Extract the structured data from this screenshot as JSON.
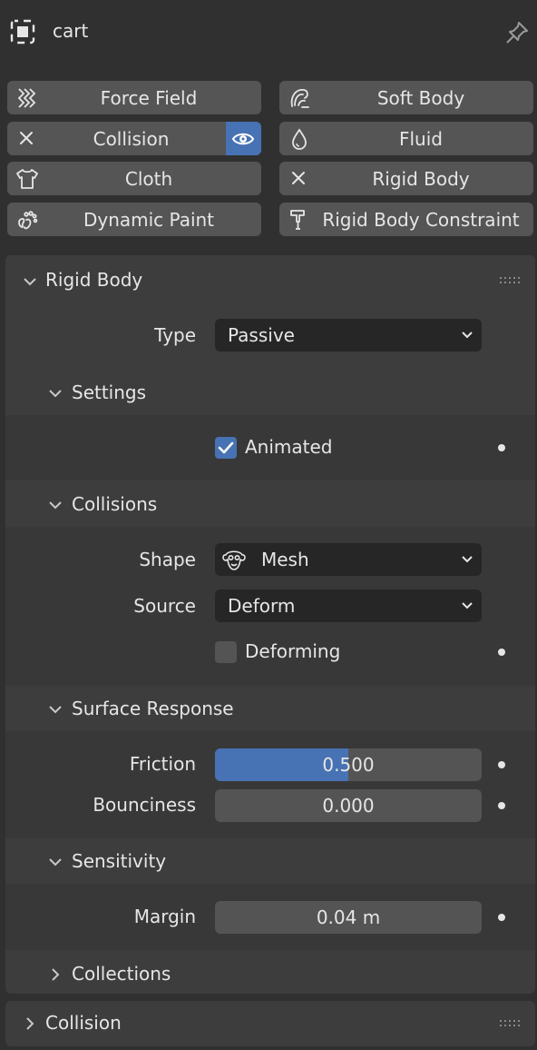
{
  "header": {
    "object_name": "cart",
    "object_icon": "object-data-icon",
    "pin_icon": "pin-icon"
  },
  "physics_buttons": [
    {
      "label": "Force Field",
      "icon": "force-field-icon"
    },
    {
      "label": "Soft Body",
      "icon": "soft-body-icon"
    },
    {
      "label": "Collision",
      "icon": "close-icon",
      "enabled": true
    },
    {
      "label": "Fluid",
      "icon": "fluid-drop-icon"
    },
    {
      "label": "Cloth",
      "icon": "cloth-shirt-icon"
    },
    {
      "label": "Rigid Body",
      "icon": "close-icon",
      "enabled": true
    },
    {
      "label": "Dynamic Paint",
      "icon": "dynamic-paint-icon"
    },
    {
      "label": "Rigid Body Constraint",
      "icon": "rigid-body-constraint-icon"
    }
  ],
  "rigid_body": {
    "title": "Rigid Body",
    "type_label": "Type",
    "type_value": "Passive",
    "settings": {
      "title": "Settings",
      "animated_label": "Animated",
      "animated": true
    },
    "collisions": {
      "title": "Collisions",
      "shape_label": "Shape",
      "shape_value": "Mesh",
      "source_label": "Source",
      "source_value": "Deform",
      "deforming_label": "Deforming",
      "deforming": false
    },
    "surface_response": {
      "title": "Surface Response",
      "friction_label": "Friction",
      "friction_value": "0.500",
      "friction_fraction": 0.5,
      "bounciness_label": "Bounciness",
      "bounciness_value": "0.000",
      "bounciness_fraction": 0.0
    },
    "sensitivity": {
      "title": "Sensitivity",
      "margin_label": "Margin",
      "margin_value": "0.04 m"
    },
    "collections": {
      "title": "Collections"
    }
  },
  "collision_panel": {
    "title": "Collision"
  },
  "colors": {
    "accent": "#4772b3",
    "panel_bg": "#3d3d3d",
    "button_bg": "#555555",
    "field_bg": "#545454",
    "dropdown_bg": "#262626",
    "window_bg": "#303030"
  }
}
